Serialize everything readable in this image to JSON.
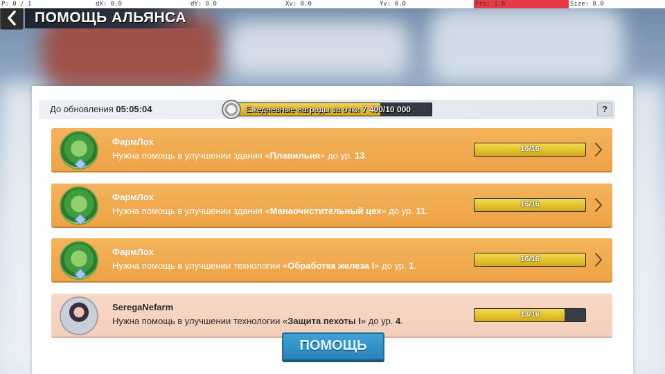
{
  "debug": {
    "p": "P: 0 / 1",
    "dx": "dX: 0.0",
    "dy": "dY: 0.0",
    "xv": "Xv: 0.0",
    "yv": "Yv: 0.0",
    "prs": "Prs: 1.0",
    "size": "Size: 0.0"
  },
  "header": {
    "title": "ПОМОЩЬ АЛЬЯНСА"
  },
  "timer": {
    "label": "До обновления",
    "value": "05:05:04"
  },
  "daily": {
    "label": "Ежедневные награды за очки",
    "value_text": "7 400/10 000",
    "current": 7400,
    "max": 10000
  },
  "help_icon_text": "?",
  "requests": [
    {
      "name": "ФармЛох",
      "pre": "Нужна помощь в улучшении здания «",
      "target": "Плавильня",
      "mid": "» до ур. ",
      "level": "13",
      "post": ".",
      "progress_text": "16/16",
      "done": 16,
      "total": 16
    },
    {
      "name": "ФармЛох",
      "pre": "Нужна помощь в улучшении здания «",
      "target": "Манаочистительный цех",
      "mid": "» до ур. ",
      "level": "11",
      "post": ".",
      "progress_text": "16/16",
      "done": 16,
      "total": 16
    },
    {
      "name": "ФармЛох",
      "pre": "Нужна помощь в улучшении технологии «",
      "target": "Обработка железа I",
      "mid": "» до ур. ",
      "level": "1",
      "post": ".",
      "progress_text": "16/16",
      "done": 16,
      "total": 16
    },
    {
      "name": "SeregaNefarm",
      "pre": "Нужна помощь в улучшении технологии «",
      "target": "Защита пехоты I",
      "mid": "» до ур. ",
      "level": "4",
      "post": ".",
      "progress_text": "13/16",
      "done": 13,
      "total": 16
    }
  ],
  "help_button": "ПОМОЩЬ",
  "colors": {
    "accent_orange": "#eea246",
    "progress_gold": "#d2ab16",
    "help_blue": "#2a84b8"
  }
}
